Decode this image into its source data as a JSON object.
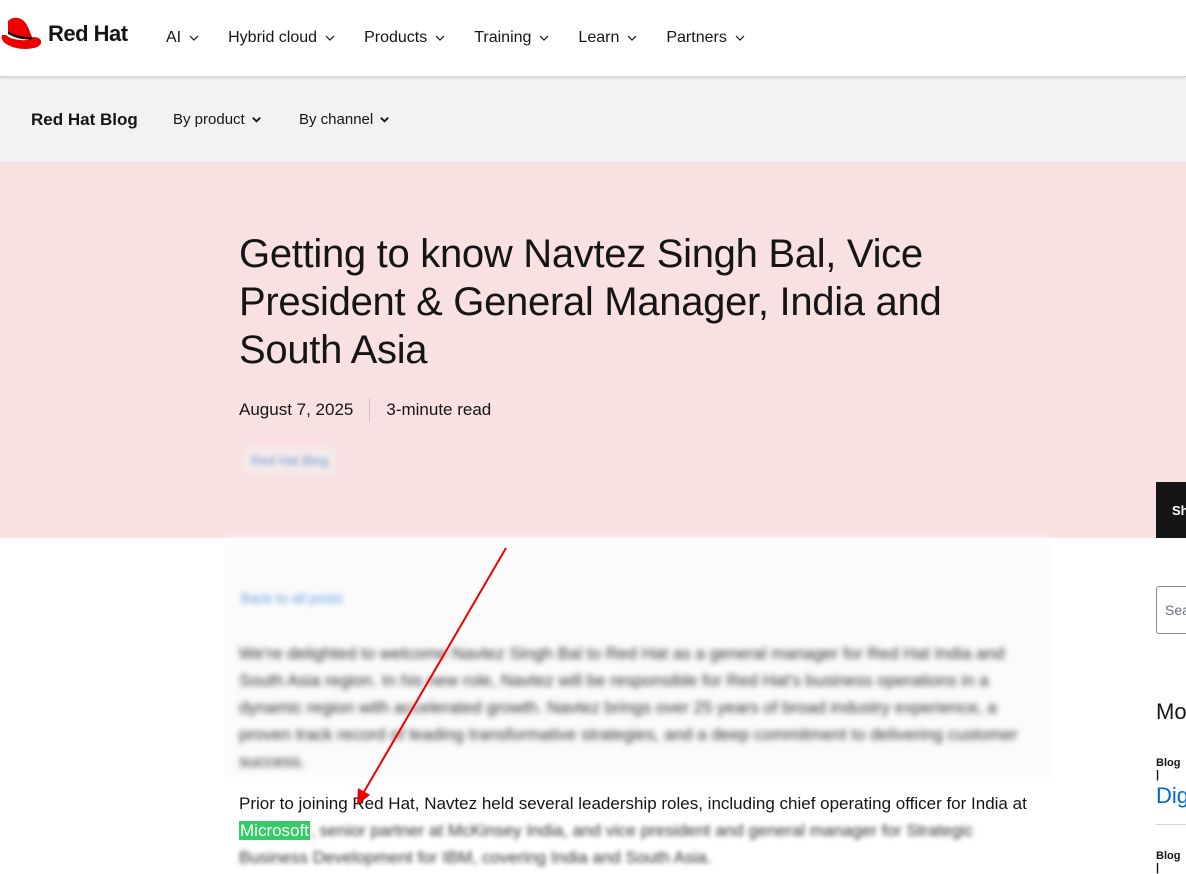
{
  "topnav": {
    "brand": "Red Hat",
    "items": [
      {
        "label": "AI"
      },
      {
        "label": "Hybrid cloud"
      },
      {
        "label": "Products"
      },
      {
        "label": "Training"
      },
      {
        "label": "Learn"
      },
      {
        "label": "Partners"
      }
    ]
  },
  "subnav": {
    "title": "Red Hat Blog",
    "by_product": "By product",
    "by_channel": "By channel"
  },
  "article": {
    "title": "Getting to know Navtez Singh Bal, Vice President & General Manager, India and South Asia",
    "date": "August 7, 2025",
    "read_time": "3-minute read",
    "tag": "Red Hat Blog",
    "back_link": "Back to all posts",
    "intro": "We're delighted to welcome Navtez Singh Bal to Red Hat as a general manager for Red Hat India and South Asia region. In his new role, Navtez will be responsible for Red Hat's business operations in a dynamic region with accelerated growth. Navtez brings over 25 years of broad industry experience, a proven track record of leading transformative strategies, and a deep commitment to delivering customer success.",
    "para_start": "Prior to joining Red Hat, Navtez held several leadership roles, including chief operating officer for India at ",
    "para_highlight": "Microsoft",
    "para_rest": ", senior partner at McKinsey India, and vice president and general manager for Strategic Business Development for IBM, covering India and South Asia."
  },
  "sidebar": {
    "share": "Sh",
    "search_placeholder": "Sea",
    "heading": "Mo",
    "label1": "Blog |",
    "link1": "Dig",
    "label2": "Blog |"
  },
  "colors": {
    "hero_bg": "#f9e0e1",
    "brand_red": "#ee0000",
    "highlight": "#33cc66",
    "arrow": "#ee0000",
    "link": "#0066cc"
  }
}
